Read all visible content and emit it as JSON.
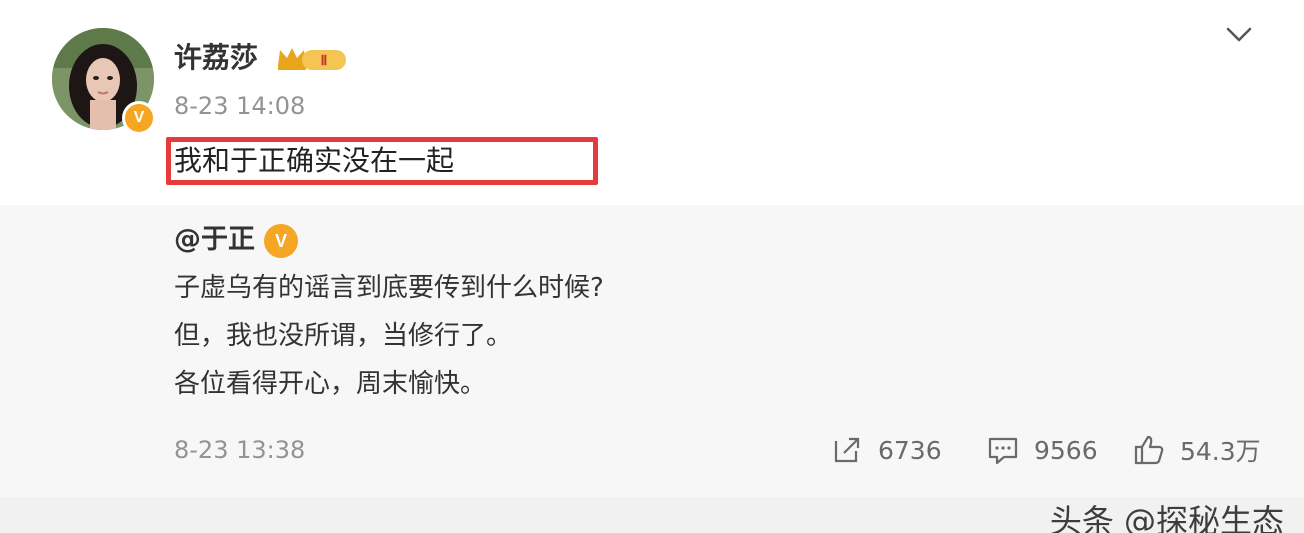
{
  "post": {
    "author": "许荔莎",
    "level_badge": "Ⅱ",
    "timestamp": "8-23 14:08",
    "text": "我和于正确实没在一起"
  },
  "repost": {
    "mention": "@于正",
    "lines": [
      "子虚乌有的谣言到底要传到什么时候?",
      "但，我也没所谓，当修行了。",
      "各位看得开心，周末愉快。"
    ],
    "timestamp": "8-23 13:38",
    "stats": {
      "reposts": "6736",
      "comments": "9566",
      "likes": "54.3万"
    }
  },
  "icons": {
    "menu": "chevron-down-icon",
    "verified": "verified-v-icon",
    "repost": "share-icon",
    "comment": "comment-icon",
    "like": "thumbs-up-icon"
  },
  "colors": {
    "highlight": "#e63b3b",
    "verified": "#f5a623",
    "muted": "#939393"
  },
  "watermark": "头条 @探秘生态"
}
